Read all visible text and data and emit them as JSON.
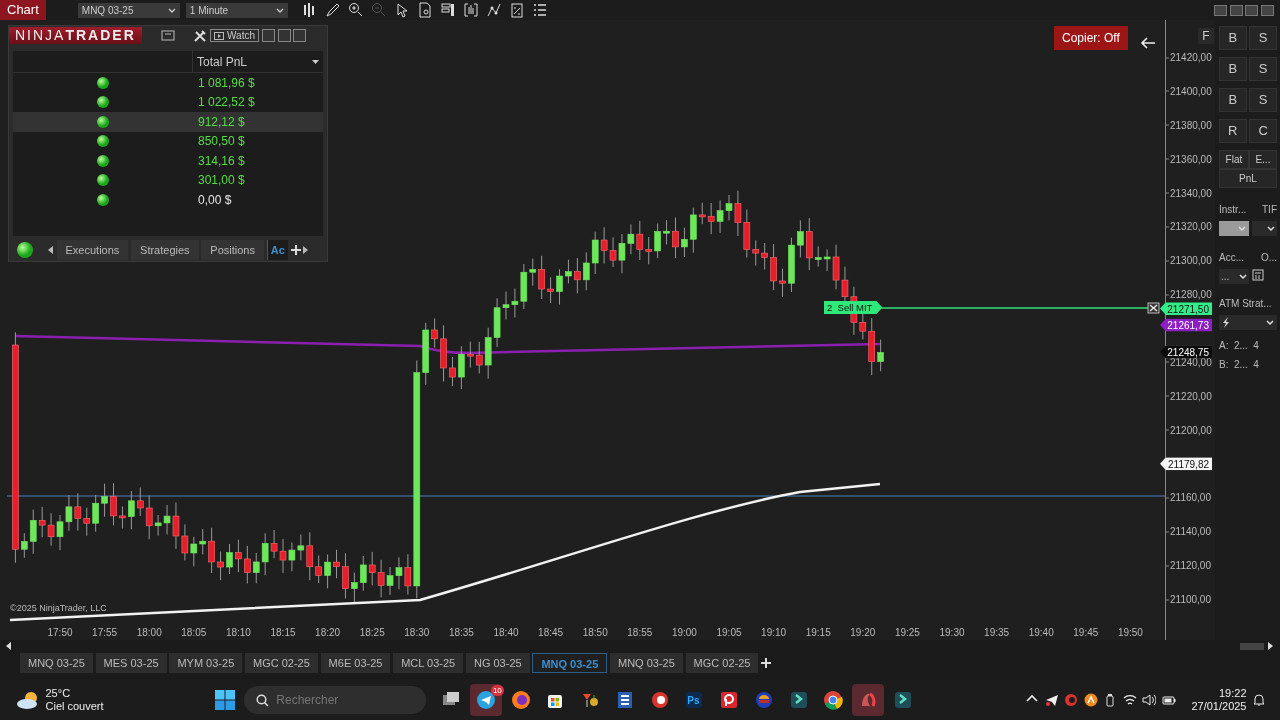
{
  "top_bar": {
    "title": "Chart",
    "instrument": "MNQ 03-25",
    "interval": "1 Minute",
    "tools": [
      {
        "kind": "bars",
        "disabled": false
      },
      {
        "kind": "pencil",
        "disabled": false
      },
      {
        "kind": "zoom-in",
        "disabled": false
      },
      {
        "kind": "zoom-out",
        "disabled": true
      },
      {
        "kind": "pointer",
        "disabled": false
      },
      {
        "kind": "document",
        "disabled": false
      },
      {
        "kind": "panel",
        "disabled": false
      },
      {
        "kind": "data",
        "disabled": false
      },
      {
        "kind": "line",
        "disabled": false
      },
      {
        "kind": "template",
        "disabled": false
      },
      {
        "kind": "list",
        "disabled": false
      }
    ]
  },
  "ninjatrader_panel": {
    "logo_light": "NINJA",
    "logo_bold": "TRADER",
    "watch": "Watch",
    "column": "Total PnL",
    "rows": [
      {
        "pnl": "1 081,96 $",
        "positive": true,
        "selected": false
      },
      {
        "pnl": "1 022,52 $",
        "positive": true,
        "selected": false
      },
      {
        "pnl": "912,12 $",
        "positive": true,
        "selected": true
      },
      {
        "pnl": "850,50 $",
        "positive": true,
        "selected": false
      },
      {
        "pnl": "314,16 $",
        "positive": true,
        "selected": false
      },
      {
        "pnl": "301,00 $",
        "positive": true,
        "selected": false
      },
      {
        "pnl": "0,00 $",
        "positive": false,
        "selected": false
      }
    ],
    "tabs": [
      {
        "label": "Executions",
        "selected": false
      },
      {
        "label": "Strategies",
        "selected": false
      },
      {
        "label": "Positions",
        "selected": false
      },
      {
        "label": "Ac",
        "selected": true
      }
    ]
  },
  "copier": {
    "label": "Copier: Off"
  },
  "chart": {
    "order_label": "2  Sell MIT",
    "copyright": "©2025 NinjaTrader, LLC"
  },
  "price_axis": {
    "ticks": [
      "21420,00",
      "21400,00",
      "21380,00",
      "21360,00",
      "21340,00",
      "21320,00",
      "21300,00",
      "21280,00",
      "21240,00",
      "21220,00",
      "21200,00",
      "21160,00",
      "21140,00",
      "21120,00",
      "21100,00"
    ],
    "markers": [
      {
        "price": "21271,50",
        "kind": "order"
      },
      {
        "price": "21261,73",
        "kind": "indicator"
      },
      {
        "price": "21248,75",
        "kind": "last"
      },
      {
        "price": "21179,82",
        "kind": "average"
      }
    ]
  },
  "time_axis": [
    "17:50",
    "17:55",
    "18:00",
    "18:05",
    "18:10",
    "18:15",
    "18:20",
    "18:25",
    "18:30",
    "18:35",
    "18:40",
    "18:45",
    "18:50",
    "18:55",
    "19:00",
    "19:05",
    "19:10",
    "19:15",
    "19:20",
    "19:25",
    "19:30",
    "19:35",
    "19:40",
    "19:45",
    "19:50"
  ],
  "order_panel": {
    "flatten": "F",
    "buy_sell": [
      [
        "B",
        "S"
      ],
      [
        "B",
        "S"
      ],
      [
        "B",
        "S"
      ]
    ],
    "reverse": "R",
    "close": "C",
    "flat": "Flat",
    "entry": "E...",
    "pnl": "PnL",
    "instrument_label": "Instr...",
    "tif_label": "TIF",
    "account_label": "Acc...",
    "order_label": "O...",
    "account_value": "...",
    "atm_label": "ATM Strat...",
    "ask": {
      "label": "A:",
      "price": "2...",
      "size": "4"
    },
    "bid": {
      "label": "B:",
      "price": "2...",
      "size": "4"
    }
  },
  "instrument_tabs": [
    {
      "label": "MNQ 03-25",
      "selected": false
    },
    {
      "label": "MES 03-25",
      "selected": false
    },
    {
      "label": "MYM 03-25",
      "selected": false
    },
    {
      "label": "MGC 02-25",
      "selected": false
    },
    {
      "label": "M6E 03-25",
      "selected": false
    },
    {
      "label": "MCL 03-25",
      "selected": false
    },
    {
      "label": "NG 03-25",
      "selected": false
    },
    {
      "label": "MNQ 03-25",
      "selected": true
    },
    {
      "label": "MNQ 03-25",
      "selected": false
    },
    {
      "label": "MGC 02-25",
      "selected": false
    }
  ],
  "taskbar": {
    "temperature": "25°C",
    "weather": "Ciel couvert",
    "search_placeholder": "Rechercher",
    "apps": [
      {
        "kind": "task-view",
        "active": false
      },
      {
        "kind": "telegram",
        "active": true,
        "badge": "10"
      },
      {
        "kind": "firefox",
        "active": false
      },
      {
        "kind": "store",
        "active": false
      },
      {
        "kind": "cocktail",
        "active": false
      },
      {
        "kind": "word",
        "active": false
      },
      {
        "kind": "cleaner",
        "active": false
      },
      {
        "kind": "photoshop",
        "active": false,
        "label": "Ps"
      },
      {
        "kind": "red-app",
        "active": false
      },
      {
        "kind": "burger",
        "active": false
      },
      {
        "kind": "arrow-app",
        "active": false
      },
      {
        "kind": "chrome",
        "active": false
      },
      {
        "kind": "ninja",
        "active": true
      },
      {
        "kind": "arrow-app",
        "active": false
      }
    ],
    "time": "19:22",
    "date": "27/01/2025"
  }
}
